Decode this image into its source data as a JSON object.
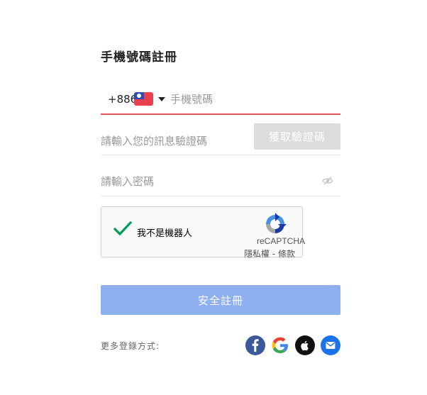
{
  "form": {
    "title": "手機號碼註冊",
    "phone": {
      "country_code": "+886",
      "flag_icon": "taiwan-flag-icon",
      "placeholder": "手機號碼",
      "value": ""
    },
    "verification": {
      "placeholder": "請輸入您的訊息驗證碼",
      "value": "",
      "button_label": "獲取驗證碼"
    },
    "password": {
      "placeholder": "請輸入密碼",
      "value": "",
      "toggle_icon": "eye-hidden-icon"
    },
    "recaptcha": {
      "checked": true,
      "label": "我不是機器人",
      "brand": "reCAPTCHA",
      "privacy_label": "隱私權",
      "separator": " - ",
      "terms_label": "條款"
    },
    "submit_label": "安全註冊",
    "more_login_label": "更多登錄方式:",
    "social_logins": [
      "facebook-icon",
      "google-icon",
      "apple-icon",
      "email-icon"
    ]
  },
  "colors": {
    "active_underline": "#e8505b",
    "disabled_button": "#dcdcdc",
    "submit_button": "#8fb0ee",
    "facebook": "#3b5998",
    "apple": "#111111",
    "email": "#1a73e8",
    "check": "#009e55"
  }
}
